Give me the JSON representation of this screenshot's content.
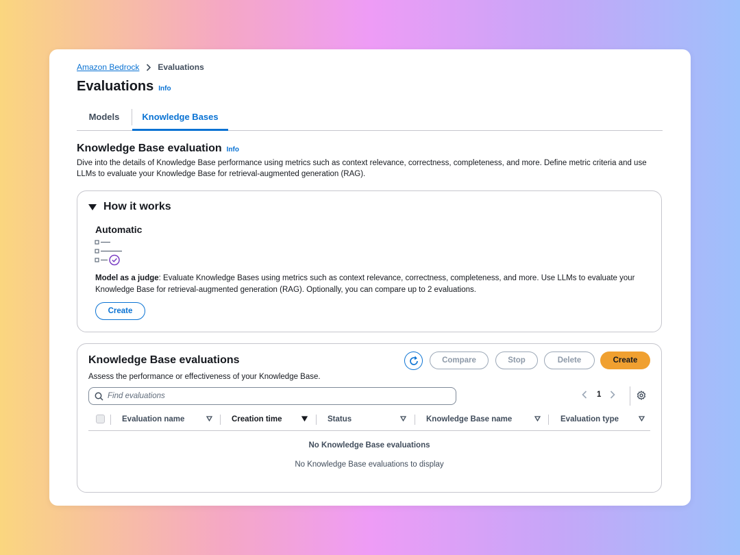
{
  "breadcrumb": {
    "parent": "Amazon Bedrock",
    "current": "Evaluations"
  },
  "page": {
    "title": "Evaluations",
    "info": "Info"
  },
  "tabs": [
    {
      "label": "Models",
      "active": false
    },
    {
      "label": "Knowledge Bases",
      "active": true
    }
  ],
  "kb_section": {
    "title": "Knowledge Base evaluation",
    "info": "Info",
    "description": "Dive into the details of Knowledge Base performance using metrics such as context relevance, correctness, completeness, and more. Define metric criteria and use LLMs to evaluate your Knowledge Base for retrieval-augmented generation (RAG)."
  },
  "how_it_works": {
    "header": "How it works",
    "card_title": "Automatic",
    "icon": "checklist-icon",
    "desc_bold": "Model as a judge",
    "desc_rest": ": Evaluate Knowledge Bases using metrics such as context relevance, correctness, completeness, and more. Use LLMs to evaluate your Knowledge Base for retrieval-augmented generation (RAG). Optionally, you can compare up to 2 evaluations.",
    "create_label": "Create"
  },
  "evaluations": {
    "title": "Knowledge Base evaluations",
    "description": "Assess the performance or effectiveness of your Knowledge Base.",
    "buttons": {
      "compare": "Compare",
      "stop": "Stop",
      "delete": "Delete",
      "create": "Create"
    },
    "search_placeholder": "Find evaluations",
    "page_number": "1",
    "columns": [
      "Evaluation name",
      "Creation time",
      "Status",
      "Knowledge Base name",
      "Evaluation type"
    ],
    "empty_title": "No Knowledge Base evaluations",
    "empty_desc": "No Knowledge Base evaluations to display"
  },
  "colors": {
    "link": "#0972d3",
    "primary_button": "#f0a030",
    "border": "#c6c6cd",
    "icon_purple": "#7b3fc4"
  }
}
